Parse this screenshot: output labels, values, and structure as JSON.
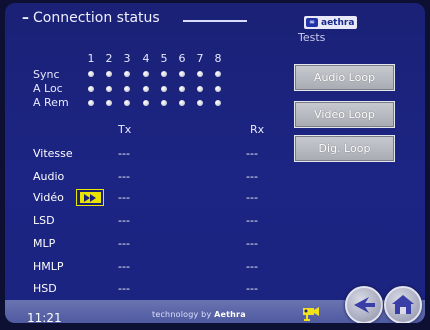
{
  "header": {
    "title": "Connection status",
    "dash": "–"
  },
  "brand": {
    "name": "aethra",
    "icon": "∞"
  },
  "tests": {
    "label": "Tests",
    "buttons": [
      {
        "id": "audio-loop",
        "label": "Audio Loop"
      },
      {
        "id": "video-loop",
        "label": "Video Loop"
      },
      {
        "id": "dig-loop",
        "label": "Dig. Loop"
      }
    ]
  },
  "grid": {
    "columns": [
      "1",
      "2",
      "3",
      "4",
      "5",
      "6",
      "7",
      "8"
    ],
    "rows": [
      "Sync",
      "A Loc",
      "A Rem"
    ]
  },
  "table": {
    "col_tx": "Tx",
    "col_rx": "Rx",
    "rows": [
      {
        "label": "Vitesse",
        "tx": "---",
        "rx": "---"
      },
      {
        "label": "Audio",
        "tx": "---",
        "rx": "---"
      },
      {
        "label": "Vidéo",
        "tx": "---",
        "rx": "---"
      },
      {
        "label": "LSD",
        "tx": "---",
        "rx": "---"
      },
      {
        "label": "MLP",
        "tx": "---",
        "rx": "---"
      },
      {
        "label": "HMLP",
        "tx": "---",
        "rx": "---"
      },
      {
        "label": "HSD",
        "tx": "---",
        "rx": "---"
      }
    ]
  },
  "footer": {
    "clock": "11:21",
    "tech_prefix": "technology by ",
    "tech_brand": "Aethra"
  },
  "colors": {
    "background": "#1c2584",
    "accent": "#e8e400",
    "button": "#b8bac2",
    "footer": "#5a64a8"
  },
  "icons": {
    "play": "fast-forward-icon",
    "camera": "camera-icon",
    "back": "back-arrow-icon",
    "home": "home-icon"
  }
}
